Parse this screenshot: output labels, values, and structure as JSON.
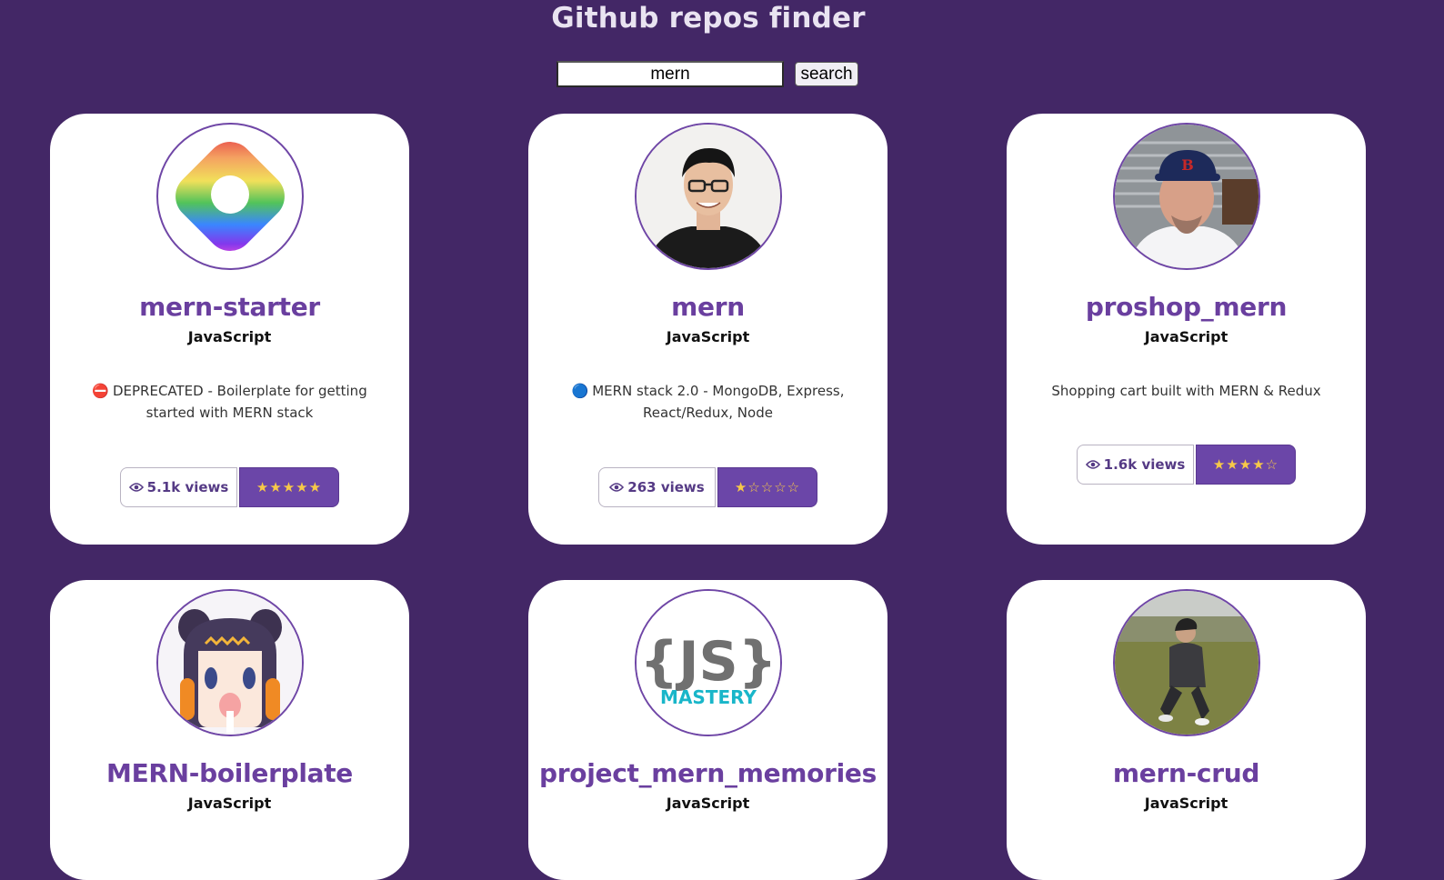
{
  "app": {
    "title": "Github repos finder"
  },
  "search": {
    "value": "mern",
    "button_label": "search"
  },
  "repos": [
    {
      "name": "mern-starter",
      "language": "JavaScript",
      "desc_icon": "⛔",
      "description": "DEPRECATED - Boilerplate for getting started with MERN stack",
      "views": "5.1k views",
      "stars": "★★★★★",
      "avatar": "rainbow-logo"
    },
    {
      "name": "mern",
      "language": "JavaScript",
      "desc_icon": "🔵",
      "description": "MERN stack 2.0 - MongoDB, Express, React/Redux, Node",
      "views": "263 views",
      "stars": "★☆☆☆☆",
      "avatar": "person-glasses"
    },
    {
      "name": "proshop_mern",
      "language": "JavaScript",
      "desc_icon": "",
      "description": "Shopping cart built with MERN & Redux",
      "views": "1.6k views",
      "stars": "★★★★☆",
      "avatar": "person-cap"
    },
    {
      "name": "MERN-boilerplate",
      "language": "JavaScript",
      "avatar": "anime-character"
    },
    {
      "name": "project_mern_memories",
      "language": "JavaScript",
      "avatar": "js-mastery-logo",
      "logo_text": "{JS}",
      "logo_subtext": "MASTERY"
    },
    {
      "name": "mern-crud",
      "language": "JavaScript",
      "avatar": "person-field"
    }
  ],
  "colors": {
    "background": "#432766",
    "accent": "#6b46a8",
    "star": "#f7c948"
  }
}
